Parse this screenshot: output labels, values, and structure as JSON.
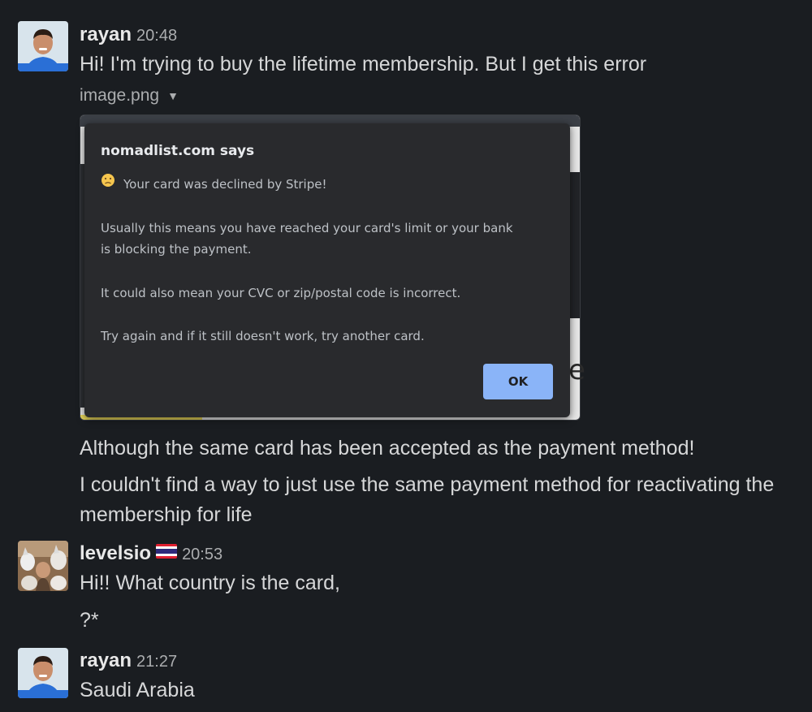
{
  "messages": [
    {
      "author": "rayan",
      "time": "20:48",
      "lines": [
        "Hi! I'm trying to buy the lifetime membership. But I get this error"
      ]
    },
    {
      "attachment": {
        "filename": "image.png",
        "caret_icon": "chevron-down-icon",
        "dialog": {
          "title": "nomadlist.com says",
          "line1": "Your card was declined by Stripe!",
          "line2": "Usually this means you have reached your card's limit or your bank",
          "line3": "is blocking the payment.",
          "line4": "It could also mean your CVC or zip/postal code is incorrect.",
          "line5": "Try again and if it still doesn't work, try another card.",
          "ok_label": "OK",
          "ok_color": "#8ab4f8"
        }
      }
    },
    {
      "lines": [
        "Although the same card has been accepted as the payment method!",
        "I couldn't find a way to just use the same payment method for reactivating the",
        "membership for life"
      ]
    },
    {
      "author": "levelsio",
      "flag_icon": "thailand-flag-icon",
      "time": "20:53",
      "lines": [
        "Hi!! What country is the card,",
        "?*"
      ]
    },
    {
      "author": "rayan",
      "time": "21:27",
      "lines": [
        "Saudi Arabia"
      ]
    }
  ],
  "colors": {
    "background": "#1a1d21",
    "text": "#d6d7d8",
    "muted": "#abadaf",
    "dialog_bg": "#292a2d"
  }
}
